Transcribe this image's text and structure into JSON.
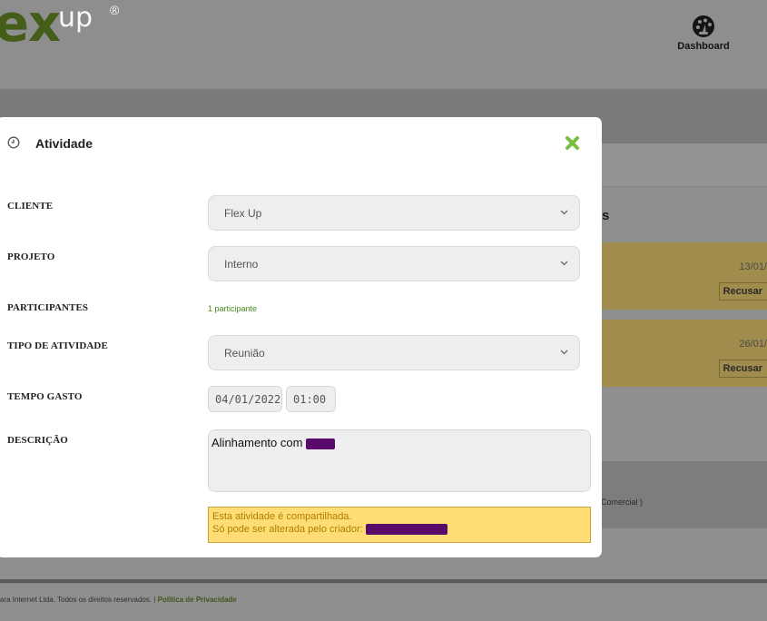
{
  "header": {
    "logo_main": "ex",
    "logo_sup": "up",
    "logo_reg": "®",
    "dashboard_label": "Dashboard"
  },
  "background": {
    "section_fragment": "s",
    "cards": [
      {
        "date": "13/01/",
        "action": "Recusar"
      },
      {
        "date": "26/01/",
        "action": "Recusar"
      }
    ],
    "comercial_fragment": "Comercial )",
    "footer_text": "ara Internet Ltda. Todos os direitos reservados. | ",
    "footer_link": "Política de Privacidade"
  },
  "modal": {
    "title": "Atividade",
    "fields": {
      "cliente": {
        "label": "CLIENTE",
        "value": "Flex Up"
      },
      "projeto": {
        "label": "PROJETO",
        "value": "Interno"
      },
      "participantes": {
        "label": "PARTICIPANTES",
        "link": "1 participante"
      },
      "tipo": {
        "label": "TIPO DE ATIVIDADE",
        "value": "Reunião"
      },
      "tempo": {
        "label": "TEMPO GASTO",
        "date": "04/01/2022",
        "time": "01:00"
      },
      "descricao": {
        "label": "DESCRIÇÃO",
        "value": "Alinhamento com"
      }
    },
    "warning": {
      "line1": "Esta atividade é compartilhada.",
      "line2": "Só pode ser alterada pelo criador: "
    }
  },
  "colors": {
    "brand_green": "#4c8a1a",
    "close_green": "#78c040",
    "warning_bg": "#fedd75",
    "redaction": "#5a0a6a"
  },
  "icons": [
    "clock-icon",
    "close-icon",
    "dashboard-gauge-icon",
    "chevron-down-icon"
  ]
}
